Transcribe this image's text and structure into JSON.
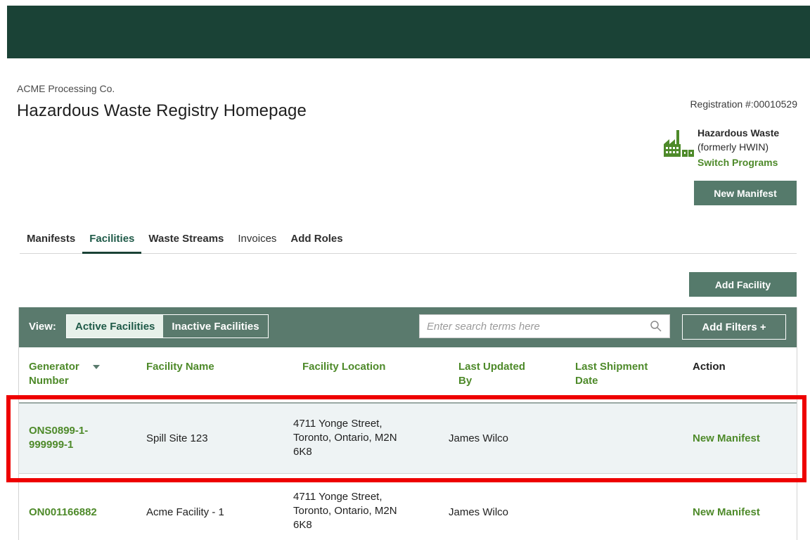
{
  "header": {
    "company": "ACME Processing Co.",
    "title": "Hazardous Waste Registry Homepage",
    "registration": "Registration #:00010529"
  },
  "program": {
    "name": "Hazardous Waste",
    "subtitle": "(formerly HWIN)",
    "switch_label": "Switch Programs",
    "icon": "factory-icon"
  },
  "buttons": {
    "new_manifest": "New Manifest",
    "add_facility": "Add Facility",
    "add_filters": "Add Filters +"
  },
  "tabs": [
    {
      "label": "Manifests"
    },
    {
      "label": "Facilities",
      "active": true
    },
    {
      "label": "Waste Streams"
    },
    {
      "label": "Invoices"
    },
    {
      "label": "Add Roles"
    }
  ],
  "toolbar": {
    "view_label": "View:",
    "view_options": [
      "Active Facilities",
      "Inactive Facilities"
    ],
    "selected_view": "Active Facilities",
    "search_placeholder": "Enter search terms here"
  },
  "table": {
    "headers": {
      "generator_line1": "Generator",
      "generator_line2": "Number",
      "facility_name": "Facility Name",
      "facility_location": "Facility Location",
      "last_updated_line1": "Last Updated",
      "last_updated_line2": "By",
      "last_shipment_line1": "Last Shipment",
      "last_shipment_line2": "Date",
      "action": "Action"
    },
    "rows": [
      {
        "generator_line1": "ONS0899-1-",
        "generator_line2": "999999-1",
        "facility_name": "Spill Site 123",
        "location_line1": "4711 Yonge Street,",
        "location_line2": "Toronto, Ontario, M2N",
        "location_line3": "6K8",
        "updated_by": "James Wilco",
        "last_shipment": "",
        "action": "New Manifest"
      },
      {
        "generator": "ON001166882",
        "facility_name": "Acme Facility - 1",
        "location_line1": "4711 Yonge Street,",
        "location_line2": "Toronto, Ontario, M2N",
        "location_line3": "6K8",
        "updated_by": "James Wilco",
        "last_shipment": "",
        "action": "New Manifest"
      }
    ]
  },
  "colors": {
    "topbar": "#1a4236",
    "accent_green": "#4e8a2a",
    "toolbar": "#5a7a6d",
    "highlight": "#ee0000"
  }
}
